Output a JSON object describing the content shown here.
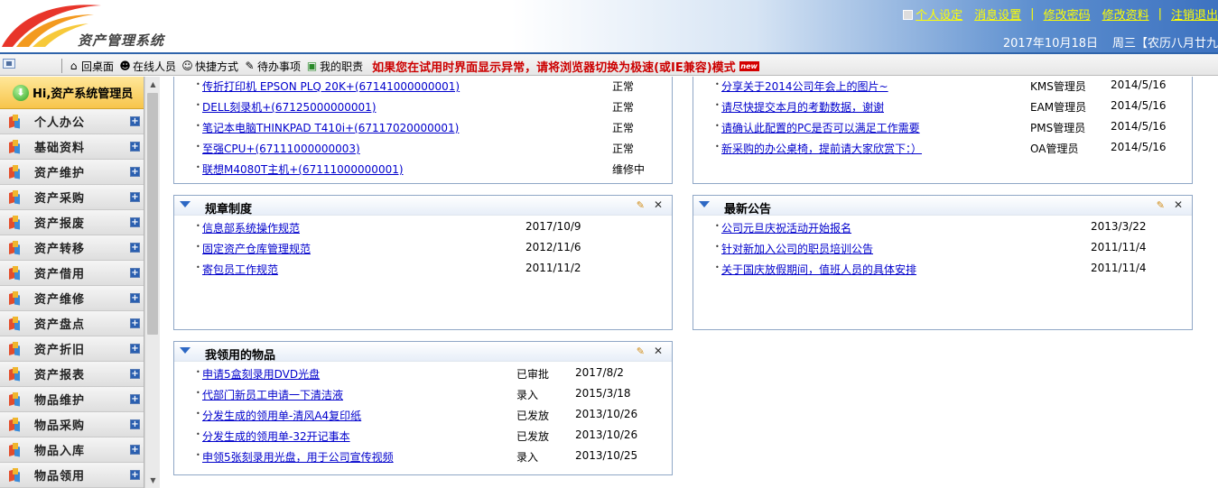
{
  "app": {
    "logo_text": "资产管理系统"
  },
  "top_links": {
    "personal_settings": "个人设定",
    "message_settings": "消息设置",
    "change_password": "修改密码",
    "edit_profile": "修改资料",
    "logout": "注销退出",
    "separator": "|"
  },
  "date_info": {
    "date": "2017年10月18日",
    "weekday_lunar": "周三【农历八月廿九"
  },
  "toolbar": {
    "home": "回桌面",
    "online_users": "在线人员",
    "shortcuts": "快捷方式",
    "todo": "待办事项",
    "my_duties": "我的职责",
    "warning": "如果您在试用时界面显示异常，请将浏览器切换为极速(或IE兼容)模式",
    "new_badge": "new"
  },
  "sidebar": {
    "welcome": "Hi,资产系统管理员",
    "items": [
      {
        "label": "个人办公"
      },
      {
        "label": "基础资料"
      },
      {
        "label": "资产维护"
      },
      {
        "label": "资产采购"
      },
      {
        "label": "资产报废"
      },
      {
        "label": "资产转移"
      },
      {
        "label": "资产借用"
      },
      {
        "label": "资产维修"
      },
      {
        "label": "资产盘点"
      },
      {
        "label": "资产折旧"
      },
      {
        "label": "资产报表"
      },
      {
        "label": "物品维护"
      },
      {
        "label": "物品采购"
      },
      {
        "label": "物品入库"
      },
      {
        "label": "物品领用"
      }
    ]
  },
  "panels": {
    "assets": {
      "rows": [
        {
          "title": "传折打印机 EPSON PLQ 20K+(67141000000001)",
          "c1": "正常"
        },
        {
          "title": "DELL刻录机+(67125000000001)",
          "c1": "正常"
        },
        {
          "title": "笔记本电脑THINKPAD T410i+(67117020000001)",
          "c1": "正常"
        },
        {
          "title": "至强CPU+(67111000000003)",
          "c1": "正常"
        },
        {
          "title": "联想M4080T主机+(67111000000001)",
          "c1": "维修中"
        }
      ]
    },
    "messages": {
      "rows": [
        {
          "title": "分享关于2014公司年会上的图片~",
          "c1": "KMS管理员",
          "c2": "2014/5/16"
        },
        {
          "title": "请尽快提交本月的考勤数据，谢谢",
          "c1": "EAM管理员",
          "c2": "2014/5/16"
        },
        {
          "title": "请确认此配置的PC是否可以满足工作需要",
          "c1": "PMS管理员",
          "c2": "2014/5/16"
        },
        {
          "title": "新采购的办公桌椅，提前请大家欣赏下：）",
          "c1": "OA管理员",
          "c2": "2014/5/16"
        }
      ]
    },
    "rules": {
      "title": "规章制度",
      "rows": [
        {
          "title": "信息部系统操作规范",
          "c1": "2017/10/9"
        },
        {
          "title": "固定资产仓库管理规范",
          "c1": "2012/11/6"
        },
        {
          "title": "寄包员工作规范",
          "c1": "2011/11/2"
        }
      ]
    },
    "notices": {
      "title": "最新公告",
      "rows": [
        {
          "title": "公司元旦庆祝活动开始报名",
          "c1": "2013/3/22"
        },
        {
          "title": "针对新加入公司的职员培训公告",
          "c1": "2011/11/4"
        },
        {
          "title": "关于国庆放假期间，值班人员的具体安排",
          "c1": "2011/11/4"
        }
      ]
    },
    "my_items": {
      "title": "我领用的物品",
      "rows": [
        {
          "title": "申请5盒刻录用DVD光盘",
          "c1": "已审批",
          "c2": "2017/8/2"
        },
        {
          "title": "代部门新员工申请一下清洁液",
          "c1": "录入",
          "c2": "2015/3/18"
        },
        {
          "title": "分发生成的领用单-清风A4复印纸",
          "c1": "已发放",
          "c2": "2013/10/26"
        },
        {
          "title": "分发生成的领用单-32开记事本",
          "c1": "已发放",
          "c2": "2013/10/26"
        },
        {
          "title": "申领5张刻录用光盘，用于公司宣传视频",
          "c1": "录入",
          "c2": "2013/10/25"
        }
      ]
    }
  },
  "colors": {
    "link": "#0000cc",
    "warning": "#cc0000",
    "header_blue": "#3d72c0",
    "top_link_yellow": "#ffff00",
    "welcome_gold": "#f7c54b"
  }
}
